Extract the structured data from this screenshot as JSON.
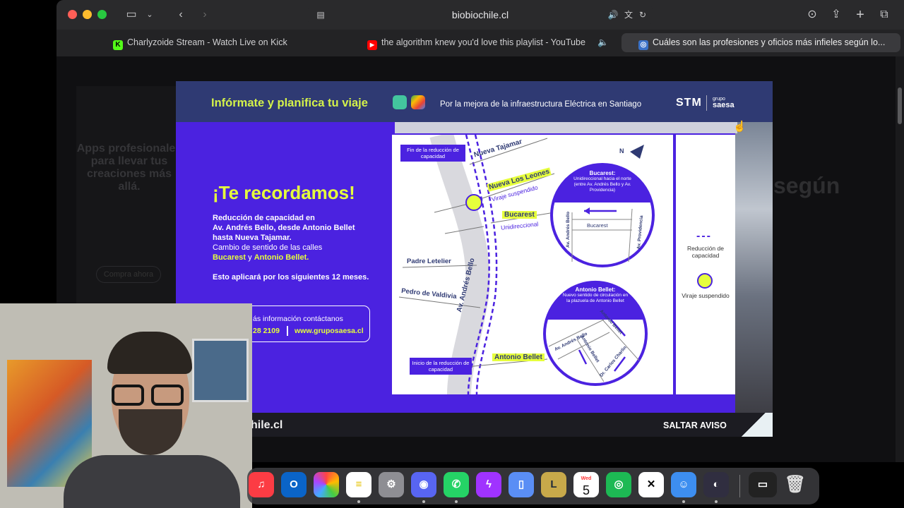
{
  "browser": {
    "address": "biobiochile.cl",
    "tabs": [
      {
        "title": "Charlyzoide Stream - Watch Live on Kick",
        "icon": "kick-icon"
      },
      {
        "title": "the algorithm knew you'd love this playlist - YouTube",
        "icon": "youtube-icon"
      },
      {
        "title": "Cuáles son las profesiones y oficios más infieles según lo...",
        "icon": "biobio-icon"
      }
    ]
  },
  "page": {
    "bg_headline": "según",
    "bg_ad_title": "Apps profesionales para llevar tus creaciones más allá.",
    "bg_ad_cta": "Compra ahora"
  },
  "ad": {
    "header_title": "Infórmate y planifica tu viaje",
    "header_subtitle": "Por la mejora de la infraestructura Eléctrica en Santiago",
    "brand": "STM",
    "brand_sub_small": "grupo",
    "brand_sub": "saesa",
    "remind_title": "¡Te recordamos!",
    "remind_line1": "Reducción de capacidad en",
    "remind_line2": "Av. Andrés Bello, desde Antonio Bellet",
    "remind_line3": "hasta Nueva Tajamar.",
    "remind_line4": "Cambio de sentido de las calles",
    "remind_bucarest": "Bucarest",
    "remind_y": " y ",
    "remind_bellet": "Antonio Bellet.",
    "remind_months": "Esto aplicará por los siguientes 12 meses.",
    "contact_text": "ás información contáctanos",
    "contact_phone": "28 2109",
    "contact_web": "www.gruposaesa.cl",
    "map": {
      "fin_label": "Fin de la reducción de capacidad",
      "inicio_label": "Inicio de la reducción de capacidad",
      "nueva_tajamar": "Nueva Tajamar",
      "nueva_los_leones": "Nueva Los Leones",
      "viraje_suspendido": "Viraje suspendido",
      "bucarest": "Bucarest",
      "unidireccional": "Unidireccional",
      "padre_letelier": "Padre Letelier",
      "pedro_valdivia": "Pedro de Valdivia",
      "av_andres_bello": "Av. Andrés Bello",
      "antonio_bellet": "Antonio Bellet",
      "north": "N",
      "circle1_title": "Bucarest:",
      "circle1_desc": "Unidireccional hacia el norte (entre Av. Andrés Bello y Av. Providencia)",
      "circle1_av_ab": "Av. Andrés Bello",
      "circle1_av_prov": "Av. Providencia",
      "circle1_street": "Bucarest",
      "circle2_title": "Antonio Bellet:",
      "circle2_desc": "Nuevo sentido de circulación en la plazuela de Antonio Bellet",
      "circle2_av_ab": "Av. Andrés Bello",
      "circle2_bellet1": "Antonio Bellet",
      "circle2_bellet2": "Antonio Bellet",
      "circle2_chaslin": "Dr. Carlos Charlin"
    },
    "legend_reduccion": "Reducción de capacidad",
    "legend_viraje": "Viraje suspendido",
    "footer_site": "hile.cl",
    "skip": "SALTAR AVISO"
  },
  "dock": {
    "calendar_month": "Wed",
    "calendar_day": "5",
    "apps": [
      "music-app",
      "outlook-app",
      "photos-app",
      "notes-app",
      "settings-app",
      "discord-app",
      "whatsapp-app",
      "messenger-app",
      "preview-app",
      "league-app",
      "calendar-app",
      "spotify-app",
      "capcut-app",
      "finder-app",
      "obs-app",
      "screen-app",
      "trash-app"
    ]
  }
}
